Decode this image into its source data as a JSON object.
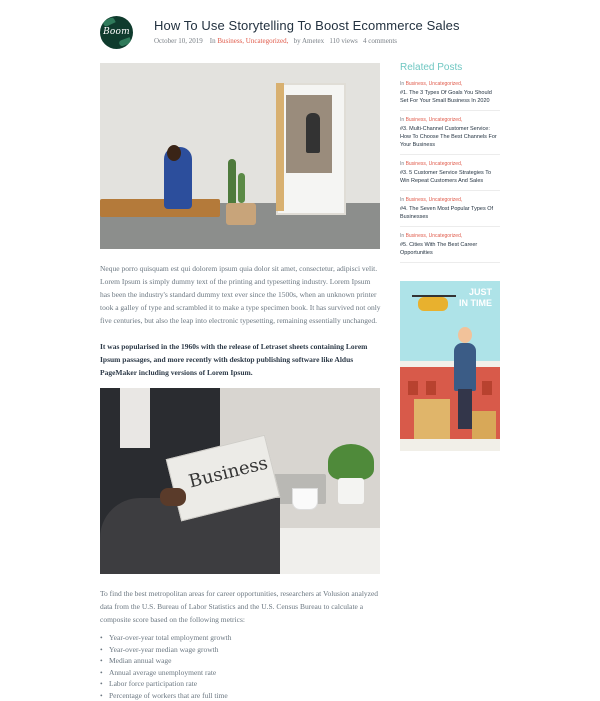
{
  "author": {
    "logo_text": "Boom"
  },
  "post": {
    "title": "How To Use Storytelling To Boost Ecommerce Sales",
    "meta": {
      "date": "October 10, 2019",
      "in_label": "In",
      "categories": "Business, Uncategorized,",
      "by_label": "by",
      "author": "Ametex",
      "views": "110 views",
      "comments": "4 comments"
    },
    "paragraph1": "Neque porro quisquam est qui dolorem ipsum quia dolor sit amet, consectetur, adipisci velit. Lorem Ipsum is simply dummy text of the printing and typesetting industry. Lorem Ipsum has been the industry's standard dummy text ever since the 1500s, when an unknown printer took a galley of type and scrambled it to make a type specimen book. It has survived not only five centuries, but also the leap into electronic typesetting, remaining essentially unchanged.",
    "paragraph2": "It was popularised in the 1960s with the release of Letraset sheets containing Lorem Ipsum passages, and more recently with desktop publishing software like Aldus PageMaker including versions of Lorem Ipsum.",
    "newspaper_word": "Business",
    "paragraph3": "To find the best metropolitan areas for career opportunities, researchers at Volusion analyzed data from the U.S. Bureau of Labor Statistics and the U.S. Census Bureau to calculate a composite score based on the following metrics:",
    "metrics": [
      "Year-over-year total employment growth",
      "Year-over-year median wage growth",
      "Median annual wage",
      "Annual average unemployment rate",
      "Labor force participation rate",
      "Percentage of workers that are full time"
    ]
  },
  "sidebar": {
    "title": "Related Posts",
    "items": [
      {
        "in": "In",
        "cats": "Business, Uncategorized,",
        "title": "#1. The 3 Types Of Goals You Should Set For Your Small Business In 2020"
      },
      {
        "in": "In",
        "cats": "Business, Uncategorized,",
        "title": "#3. Multi-Channel Customer Service: How To Choose The Best Channels For Your Business"
      },
      {
        "in": "In",
        "cats": "Business, Uncategorized,",
        "title": "#3. 5 Customer Service Strategies To Win Repeat Customers And Sales"
      },
      {
        "in": "In",
        "cats": "Business, Uncategorized,",
        "title": "#4. The Seven Most Popular Types Of Businesses"
      },
      {
        "in": "In",
        "cats": "Business, Uncategorized,",
        "title": "#5. Cities With The Best Career Opportunities"
      }
    ],
    "ad": {
      "line1": "JUST",
      "line2": "IN TIME"
    }
  },
  "colors": {
    "accent": "#6fc7c2",
    "category": "#e05b4b",
    "title": "#233240",
    "body": "#6b7781"
  }
}
